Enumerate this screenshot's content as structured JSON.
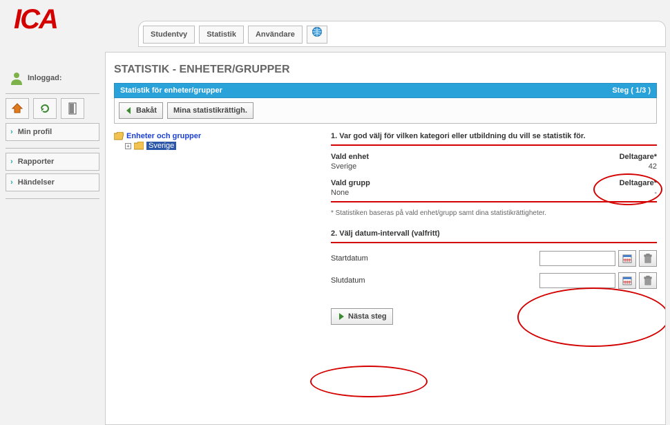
{
  "logo_text": "ICA",
  "tabs": {
    "student": "Studentvy",
    "stats": "Statistik",
    "users": "Användare"
  },
  "sidebar": {
    "loggedin_label": "Inloggad:",
    "myprofile": "Min profil",
    "reports": "Rapporter",
    "events": "Händelser"
  },
  "page": {
    "title": "STATISTIK - ENHETER/GRUPPER",
    "stepbar_left": "Statistik för enheter/grupper",
    "stepbar_right": "Steg ( 1/3 )",
    "back": "Bakåt",
    "permissions": "Mina statistikrättigh."
  },
  "tree": {
    "root": "Enheter och grupper",
    "child": "Sverige"
  },
  "section1": {
    "heading": "1. Var god välj för vilken kategori eller utbildning du vill se statistik för.",
    "selected_unit_label": "Vald enhet",
    "selected_unit_value": "Sverige",
    "participants_label": "Deltagare*",
    "participants_unit": "42",
    "selected_group_label": "Vald grupp",
    "selected_group_value": "None",
    "participants_group": "-",
    "footnote": "* Statistiken baseras på vald enhet/grupp samt dina statistikrättigheter."
  },
  "section2": {
    "heading": "2. Välj datum-intervall (valfritt)",
    "start_label": "Startdatum",
    "end_label": "Slutdatum",
    "start_value": "",
    "end_value": ""
  },
  "actions": {
    "next": "Nästa steg"
  }
}
